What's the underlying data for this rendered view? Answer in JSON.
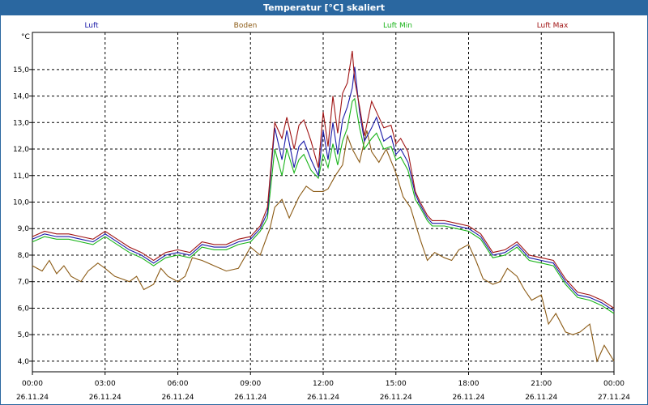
{
  "chart_data": {
    "type": "line",
    "title": "Temperatur [°C] skaliert",
    "yunit": "°C",
    "ylim": [
      3.6,
      16.4
    ],
    "yticks": [
      "4,0",
      "5,0",
      "6,0",
      "7,0",
      "8,0",
      "9,0",
      "10,0",
      "11,0",
      "12,0",
      "13,0",
      "14,0",
      "15,0"
    ],
    "yticks_values": [
      4,
      5,
      6,
      7,
      8,
      9,
      10,
      11,
      12,
      13,
      14,
      15
    ],
    "xlim": [
      0,
      24
    ],
    "xticks": [
      {
        "value": 0,
        "time": "00:00",
        "date": "26.11.24"
      },
      {
        "value": 3,
        "time": "03:00",
        "date": "26.11.24"
      },
      {
        "value": 6,
        "time": "06:00",
        "date": "26.11.24"
      },
      {
        "value": 9,
        "time": "09:00",
        "date": "26.11.24"
      },
      {
        "value": 12,
        "time": "12:00",
        "date": "26.11.24"
      },
      {
        "value": 15,
        "time": "15:00",
        "date": "26.11.24"
      },
      {
        "value": 18,
        "time": "18:00",
        "date": "26.11.24"
      },
      {
        "value": 21,
        "time": "21:00",
        "date": "26.11.24"
      },
      {
        "value": 24,
        "time": "00:00",
        "date": "27.11.24"
      }
    ],
    "grid": true,
    "legend_placement": "top",
    "series": [
      {
        "name": "Luft",
        "color": "#1a1aa8",
        "x": [
          0,
          0.5,
          1,
          1.5,
          2,
          2.5,
          3,
          3.5,
          4,
          4.5,
          5,
          5.5,
          6,
          6.5,
          7,
          7.5,
          8,
          8.5,
          9,
          9.4,
          9.7,
          10,
          10.3,
          10.5,
          10.8,
          11,
          11.2,
          11.5,
          11.8,
          12,
          12.2,
          12.4,
          12.6,
          12.8,
          13,
          13.2,
          13.3,
          13.5,
          13.7,
          14,
          14.2,
          14.5,
          14.8,
          15,
          15.2,
          15.5,
          15.8,
          16,
          16.3,
          16.5,
          17,
          17.5,
          18,
          18.5,
          19,
          19.5,
          20,
          20.5,
          21,
          21.5,
          22,
          22.5,
          23,
          23.5,
          24
        ],
        "y": [
          8.6,
          8.8,
          8.7,
          8.7,
          8.6,
          8.5,
          8.8,
          8.5,
          8.2,
          8.0,
          7.7,
          8.0,
          8.1,
          8.0,
          8.4,
          8.3,
          8.3,
          8.5,
          8.6,
          9.0,
          9.6,
          12.8,
          11.6,
          12.7,
          11.3,
          12.1,
          12.3,
          11.6,
          11.0,
          12.7,
          11.6,
          13.0,
          11.8,
          13.1,
          13.6,
          14.3,
          15.1,
          13.4,
          12.3,
          12.8,
          13.2,
          12.3,
          12.5,
          11.8,
          12.0,
          11.5,
          10.3,
          9.9,
          9.4,
          9.2,
          9.2,
          9.1,
          9.0,
          8.7,
          8.0,
          8.1,
          8.4,
          7.9,
          7.8,
          7.7,
          7.0,
          6.5,
          6.4,
          6.2,
          5.9
        ]
      },
      {
        "name": "Boden",
        "color": "#8b5a14",
        "x": [
          0,
          0.4,
          0.7,
          1.0,
          1.3,
          1.6,
          2.0,
          2.3,
          2.7,
          3.0,
          3.4,
          3.7,
          4.0,
          4.3,
          4.6,
          5.0,
          5.3,
          5.6,
          6.0,
          6.3,
          6.6,
          7.0,
          7.5,
          8.0,
          8.5,
          9.0,
          9.4,
          9.8,
          10.0,
          10.3,
          10.6,
          11.0,
          11.3,
          11.6,
          12.0,
          12.2,
          12.5,
          12.8,
          13.0,
          13.2,
          13.5,
          13.8,
          14.0,
          14.3,
          14.6,
          15.0,
          15.3,
          15.6,
          16.0,
          16.3,
          16.6,
          17.0,
          17.3,
          17.6,
          18.0,
          18.3,
          18.6,
          19.0,
          19.3,
          19.6,
          20.0,
          20.3,
          20.6,
          21.0,
          21.3,
          21.6,
          22.0,
          22.3,
          22.6,
          23.0,
          23.3,
          23.6,
          24.0
        ],
        "y": [
          7.6,
          7.4,
          7.8,
          7.3,
          7.6,
          7.2,
          7.0,
          7.4,
          7.7,
          7.5,
          7.2,
          7.1,
          7.0,
          7.2,
          6.7,
          6.9,
          7.5,
          7.2,
          7.0,
          7.2,
          7.9,
          7.8,
          7.6,
          7.4,
          7.5,
          8.3,
          8.0,
          9.0,
          9.8,
          10.1,
          9.4,
          10.2,
          10.6,
          10.4,
          10.4,
          10.5,
          11.0,
          11.4,
          12.5,
          12.0,
          11.5,
          12.7,
          11.9,
          11.5,
          12.0,
          11.1,
          10.2,
          9.8,
          8.6,
          7.8,
          8.1,
          7.9,
          7.8,
          8.2,
          8.4,
          7.8,
          7.1,
          6.9,
          7.0,
          7.5,
          7.2,
          6.7,
          6.3,
          6.5,
          5.4,
          5.8,
          5.1,
          5.0,
          5.1,
          5.4,
          4.0,
          4.6,
          4.0
        ]
      },
      {
        "name": "Luft Min",
        "color": "#19b419",
        "x": [
          0,
          0.5,
          1,
          1.5,
          2,
          2.5,
          3,
          3.5,
          4,
          4.5,
          5,
          5.5,
          6,
          6.5,
          7,
          7.5,
          8,
          8.5,
          9,
          9.4,
          9.7,
          10,
          10.3,
          10.5,
          10.8,
          11,
          11.2,
          11.5,
          11.8,
          12,
          12.2,
          12.4,
          12.6,
          12.8,
          13,
          13.2,
          13.3,
          13.5,
          13.7,
          14,
          14.2,
          14.5,
          14.8,
          15,
          15.2,
          15.5,
          15.8,
          16,
          16.3,
          16.5,
          17,
          17.5,
          18,
          18.5,
          19,
          19.5,
          20,
          20.5,
          21,
          21.5,
          22,
          22.5,
          23,
          23.5,
          24
        ],
        "y": [
          8.5,
          8.7,
          8.6,
          8.6,
          8.5,
          8.4,
          8.7,
          8.4,
          8.1,
          7.9,
          7.6,
          7.9,
          8.0,
          7.9,
          8.3,
          8.2,
          8.2,
          8.4,
          8.5,
          8.9,
          9.4,
          12.0,
          11.0,
          12.0,
          11.1,
          11.6,
          11.8,
          11.2,
          10.9,
          11.8,
          11.3,
          12.2,
          11.4,
          12.3,
          12.8,
          13.8,
          13.9,
          12.8,
          12.0,
          12.4,
          12.6,
          12.0,
          12.1,
          11.6,
          11.7,
          11.2,
          10.1,
          9.8,
          9.3,
          9.1,
          9.1,
          9.0,
          8.9,
          8.6,
          7.9,
          8.0,
          8.3,
          7.8,
          7.7,
          7.6,
          6.9,
          6.4,
          6.3,
          6.1,
          5.8
        ]
      },
      {
        "name": "Luft Max",
        "color": "#a01414",
        "x": [
          0,
          0.5,
          1,
          1.5,
          2,
          2.5,
          3,
          3.5,
          4,
          4.5,
          5,
          5.5,
          6,
          6.5,
          7,
          7.5,
          8,
          8.5,
          9,
          9.4,
          9.7,
          10,
          10.3,
          10.5,
          10.8,
          11,
          11.2,
          11.5,
          11.8,
          12,
          12.2,
          12.4,
          12.6,
          12.8,
          13,
          13.2,
          13.3,
          13.5,
          13.7,
          14,
          14.2,
          14.5,
          14.8,
          15,
          15.2,
          15.5,
          15.8,
          16,
          16.3,
          16.5,
          17,
          17.5,
          18,
          18.5,
          19,
          19.5,
          20,
          20.5,
          21,
          21.5,
          22,
          22.5,
          23,
          23.5,
          24
        ],
        "y": [
          8.7,
          8.9,
          8.8,
          8.8,
          8.7,
          8.6,
          8.9,
          8.6,
          8.3,
          8.1,
          7.8,
          8.1,
          8.2,
          8.1,
          8.5,
          8.4,
          8.4,
          8.6,
          8.7,
          9.1,
          9.8,
          13.0,
          12.4,
          13.2,
          12.0,
          12.9,
          13.1,
          12.3,
          11.3,
          13.4,
          12.1,
          14.0,
          12.6,
          14.1,
          14.5,
          15.7,
          14.6,
          13.6,
          12.5,
          13.8,
          13.4,
          12.8,
          12.9,
          12.2,
          12.4,
          11.9,
          10.4,
          10.0,
          9.5,
          9.3,
          9.3,
          9.2,
          9.1,
          8.8,
          8.1,
          8.2,
          8.5,
          8.0,
          7.9,
          7.8,
          7.1,
          6.6,
          6.5,
          6.3,
          6.0
        ]
      }
    ]
  }
}
